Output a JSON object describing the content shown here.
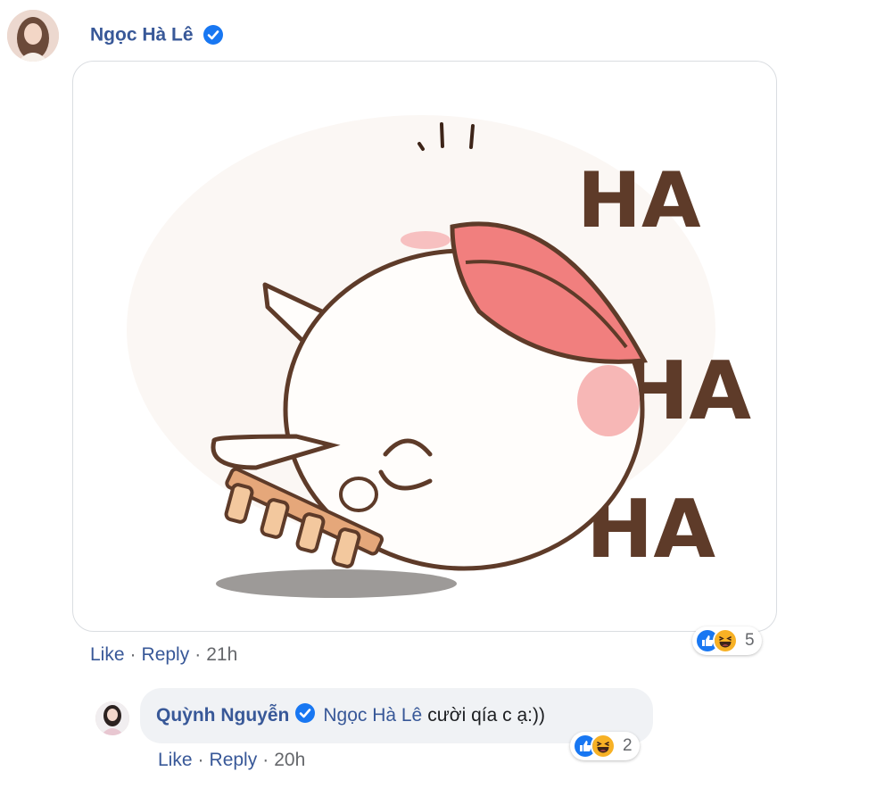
{
  "comment": {
    "author": "Ngọc Hà Lê",
    "sticker_text": [
      "HA",
      "HA",
      "HA"
    ],
    "actions": {
      "like": "Like",
      "reply": "Reply",
      "separator": "·",
      "time": "21h"
    },
    "reactions": {
      "icons": [
        "like-icon",
        "haha-icon"
      ],
      "count": "5"
    }
  },
  "reply": {
    "author": "Quỳnh Nguyễn",
    "mention": "Ngọc Hà Lê",
    "text": "cười qía c ạ:))",
    "actions": {
      "like": "Like",
      "reply": "Reply",
      "separator": "·",
      "time": "20h"
    },
    "reactions": {
      "icons": [
        "like-icon",
        "haha-icon"
      ],
      "count": "2"
    }
  },
  "colors": {
    "link": "#385898",
    "meta": "#65676b",
    "bubble": "#f0f2f5",
    "verified": "#1877f2",
    "like": "#1877f2",
    "haha": "#f7b125"
  }
}
